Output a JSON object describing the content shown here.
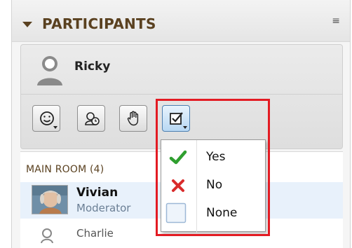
{
  "header": {
    "title": "PARTICIPANTS",
    "menu_icon": "≡"
  },
  "user": {
    "name": "Ricky",
    "icon": "person-silhouette-icon"
  },
  "toolbar": {
    "buttons": [
      {
        "name": "emoticon-button",
        "icon": "smiley-icon"
      },
      {
        "name": "away-button",
        "icon": "clock-person-icon"
      },
      {
        "name": "raise-hand-button",
        "icon": "hand-icon"
      },
      {
        "name": "status-button",
        "icon": "checkbox-icon",
        "active": true
      }
    ]
  },
  "room": {
    "heading": "MAIN ROOM (4)",
    "participants": [
      {
        "name": "Vivian",
        "role": "Moderator"
      },
      {
        "name": "Charlie",
        "role": ""
      }
    ]
  },
  "status_menu": {
    "items": [
      {
        "label": "Yes",
        "icon": "green-check-icon"
      },
      {
        "label": "No",
        "icon": "red-x-icon"
      },
      {
        "label": "None",
        "icon": "empty-box-icon"
      }
    ]
  },
  "colors": {
    "header_text": "#5a4120",
    "highlight": "#e31b23",
    "yes": "#2f9f2f",
    "no": "#d92b2b",
    "moderator": "#6b7f95"
  }
}
